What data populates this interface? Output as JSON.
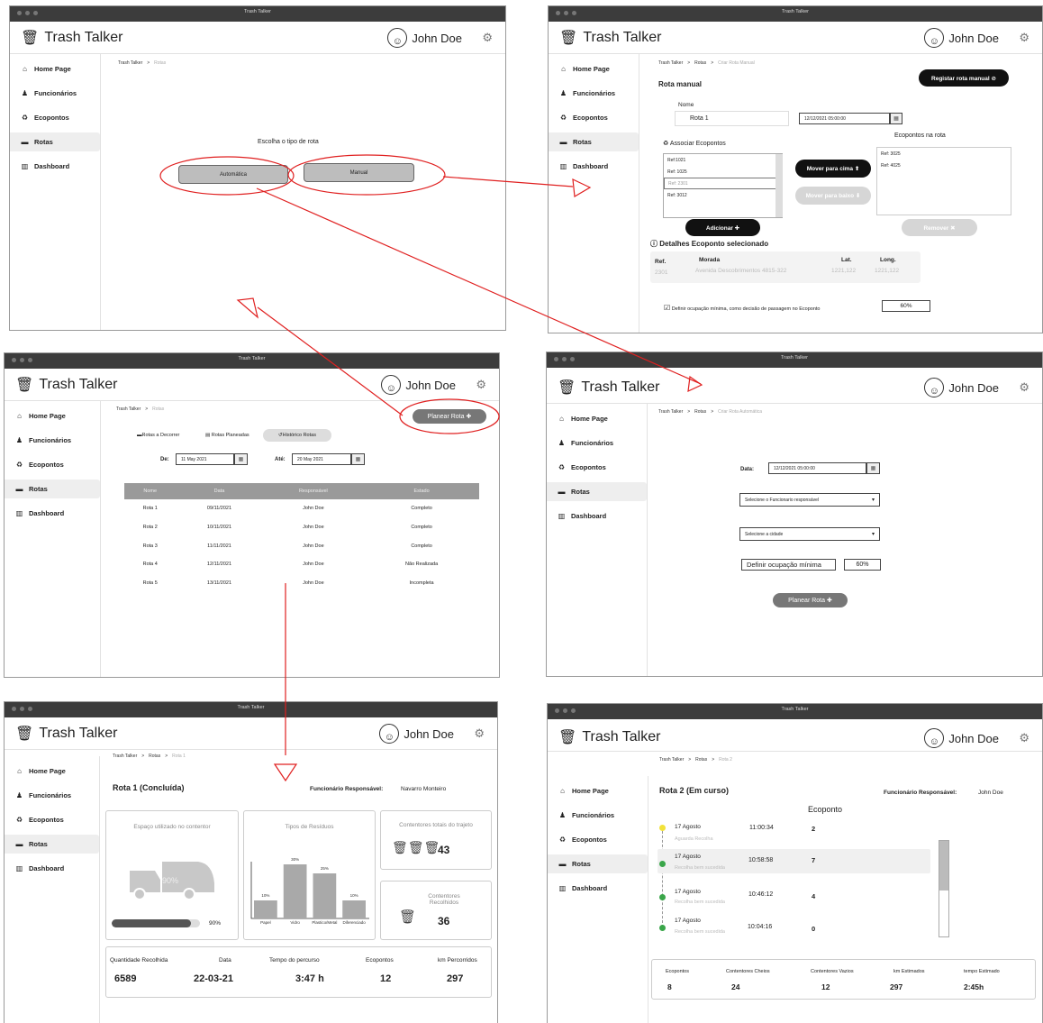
{
  "common": {
    "window_title": "Trash Talker",
    "app_name": "Trash Talker",
    "user_name": "John Doe",
    "nav": [
      "Home Page",
      "Funcionários",
      "Ecopontos",
      "Rotas",
      "Dashboard"
    ],
    "crumb_root": "Trash Talker",
    "crumb_rotas": "Rotas",
    "crumb_sep": ">"
  },
  "w1": {
    "prompt": "Escolha o tipo de rota",
    "automatic": "Automática",
    "manual": "Manual"
  },
  "w2": {
    "crumb_current": "Criar Rota Manual",
    "register_button": "Registar rota manual ⊘",
    "section_title": "Rota manual",
    "name_label": "Nome",
    "name_value": "Rota 1",
    "date_value": "12/12/2021 05:00:00",
    "associate_label": "Associar Ecopontos",
    "ecopontos_list": [
      "Ref:1021",
      "Ref: 1025",
      "Ref: 2301",
      "Ref: 3012"
    ],
    "route_label": "Ecopontos na rota",
    "route_list": [
      "Ref: 3025",
      "Ref: 4025"
    ],
    "move_up": "Mover para cima ⬆",
    "move_down": "Mover para baixo ⬇",
    "add": "Adicionar ✚",
    "remove": "Remover ✖",
    "details_title": "Detalhes Ecoponto selecionado",
    "details_headers": [
      "Ref.",
      "Morada",
      "Lat.",
      "Long."
    ],
    "details_values": [
      "2301",
      "Avenida Descobrimentos 4815-322",
      "1221,122",
      "1221,122"
    ],
    "min_occupancy_label": "Definir ocupação mínima, como decisão de passagem no Ecoponto",
    "min_occupancy_value": "60%"
  },
  "w3": {
    "plan_button": "Planear Rota ✚",
    "tabs": [
      "Rotas a Decorrer",
      "Rotas Planeadas",
      "Histórico Rotas"
    ],
    "from_label": "De:",
    "from_value": "11 May 2021",
    "to_label": "Até:",
    "to_value": "20 May 2021",
    "headers": [
      "Nome",
      "Data",
      "Responsável",
      "Estado"
    ],
    "rows": [
      [
        "Rota 1",
        "09/11/2021",
        "John Doe",
        "Completo"
      ],
      [
        "Rota 2",
        "10/11/2021",
        "John Doe",
        "Completo"
      ],
      [
        "Rota 3",
        "11/11/2021",
        "John Doe",
        "Completo"
      ],
      [
        "Rota 4",
        "12/11/2021",
        "John Doe",
        "Não Realizada"
      ],
      [
        "Rota 5",
        "13/11/2021",
        "John Doe",
        "Incompleta"
      ]
    ]
  },
  "w4": {
    "crumb_current": "Criar Rota Automática",
    "date_label": "Data:",
    "date_value": "12/12/2021 05:00:00",
    "employee_select": "Selecione o Funcionario responsável",
    "city_select": "Selecione a cidade",
    "min_occupancy_label": "Definir ocupação mínima",
    "min_occupancy_value": "60%",
    "plan_button": "Planear Rota ✚"
  },
  "w5": {
    "crumb_current": "Rota 1",
    "title": "Rota 1 (Concluída)",
    "employee_label": "Funcionário Responsável:",
    "employee_value": "Navarro Monteiro",
    "space_title": "Espaço utilizado no contentor",
    "truck_percent": "90%",
    "space_percent_label": "90%",
    "space_fraction": 0.9,
    "waste_title": "Tipos de Resíduos",
    "containers_total_title": "Contentores totais do trajeto",
    "containers_total_value": "43",
    "containers_collected_title": "Contentores Recolhidos",
    "containers_collected_value": "36",
    "stats_headers": [
      "Quantidade Recolhida",
      "Data",
      "Tempo do percurso",
      "Ecopontos",
      "km Percorridos"
    ],
    "stats_values": [
      "6589",
      "22-03-21",
      "3:47 h",
      "12",
      "297"
    ]
  },
  "chart_data": {
    "type": "bar",
    "title": "Tipos de Resíduos",
    "categories": [
      "Papel",
      "Vidro",
      "Plastico/Metal",
      "Diferenciado"
    ],
    "values": [
      10,
      30,
      25,
      10
    ],
    "value_labels": [
      "10%",
      "30%",
      "25%",
      "10%"
    ],
    "color": "#a9a9a9"
  },
  "w6": {
    "crumb_current": "Rota 2",
    "title": "Rota 2 (Em curso)",
    "employee_label": "Funcionário Responsável:",
    "employee_value": "John Doe",
    "ecoponto_header": "Ecoponto",
    "timeline": [
      {
        "date": "17 Agosto",
        "status": "Aguarda Recolha",
        "time": "11:00:34",
        "eco": "2",
        "color": "#f2e23a"
      },
      {
        "date": "17 Agosto",
        "status": "Recolha bem sucedida",
        "time": "10:58:58",
        "eco": "7",
        "color": "#3aa64a"
      },
      {
        "date": "17 Agosto",
        "status": "Recolha bem sucedida",
        "time": "10:46:12",
        "eco": "4",
        "color": "#3aa64a"
      },
      {
        "date": "17 Agosto",
        "status": "Recolha bem sucedida",
        "time": "10:04:16",
        "eco": "0",
        "color": "#3aa64a"
      }
    ],
    "stats_headers": [
      "Ecopontos",
      "Contentores Cheios",
      "Contentores Vazios",
      "km Estimados",
      "tempo Estimado"
    ],
    "stats_values": [
      "8",
      "24",
      "12",
      "297",
      "2:45h"
    ]
  }
}
